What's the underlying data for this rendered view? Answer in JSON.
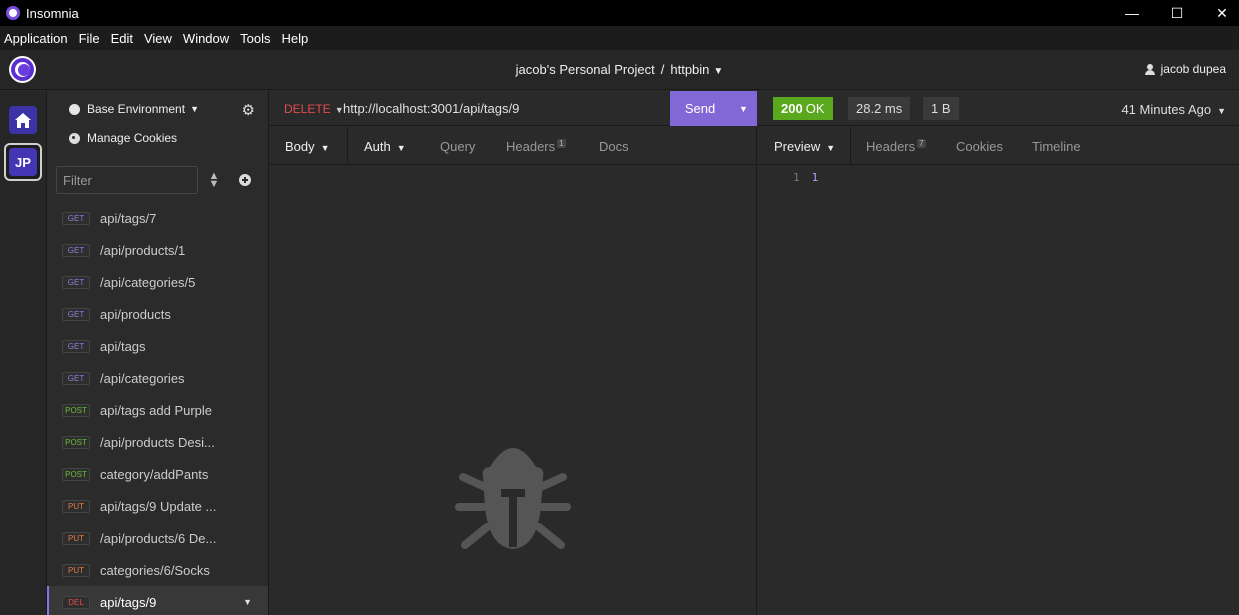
{
  "window": {
    "title": "Insomnia",
    "minimize": "—",
    "maximize": "☐",
    "close": "✕"
  },
  "menu": [
    "Application",
    "File",
    "Edit",
    "View",
    "Window",
    "Tools",
    "Help"
  ],
  "header": {
    "project": "jacob's Personal Project",
    "separator": "/",
    "collection": "httpbin",
    "user": "jacob dupea"
  },
  "rail": {
    "avatar_initials": "JP"
  },
  "sidebar": {
    "environment": "Base Environment",
    "manage_cookies": "Manage Cookies",
    "filter_placeholder": "Filter",
    "requests": [
      {
        "method": "GET",
        "name": "api/tags/7",
        "color": "#8a82d9"
      },
      {
        "method": "GET",
        "name": "/api/products/1",
        "color": "#8a82d9"
      },
      {
        "method": "GET",
        "name": "/api/categories/5",
        "color": "#8a82d9"
      },
      {
        "method": "GET",
        "name": "api/products",
        "color": "#8a82d9"
      },
      {
        "method": "GET",
        "name": "api/tags",
        "color": "#8a82d9"
      },
      {
        "method": "GET",
        "name": "/api/categories",
        "color": "#8a82d9"
      },
      {
        "method": "POST",
        "name": "api/tags add Purple",
        "color": "#6cbf36"
      },
      {
        "method": "POST",
        "name": "/api/products Desi...",
        "color": "#6cbf36"
      },
      {
        "method": "POST",
        "name": "category/addPants",
        "color": "#6cbf36"
      },
      {
        "method": "PUT",
        "name": "api/tags/9 Update ...",
        "color": "#e57a3c"
      },
      {
        "method": "PUT",
        "name": "/api/products/6 De...",
        "color": "#e57a3c"
      },
      {
        "method": "PUT",
        "name": "categories/6/Socks",
        "color": "#e57a3c"
      },
      {
        "method": "DEL",
        "name": "api/tags/9",
        "color": "#e54b4b"
      }
    ]
  },
  "request": {
    "method": "DELETE",
    "url": "http://localhost:3001/api/tags/9",
    "send_label": "Send",
    "tabs": {
      "body": "Body",
      "auth": "Auth",
      "query": "Query",
      "headers": "Headers",
      "headers_count": "1",
      "docs": "Docs"
    }
  },
  "response": {
    "status_code": "200",
    "status_text": "OK",
    "time": "28.2 ms",
    "size": "1 B",
    "age": "41 Minutes Ago",
    "tabs": {
      "preview": "Preview",
      "headers": "Headers",
      "headers_count": "7",
      "cookies": "Cookies",
      "timeline": "Timeline"
    },
    "line_number": "1",
    "body_value": "1"
  },
  "colors": {
    "accent": "#8268d6",
    "status_ok": "#5aa81e",
    "delete_method": "#e54b4b"
  }
}
